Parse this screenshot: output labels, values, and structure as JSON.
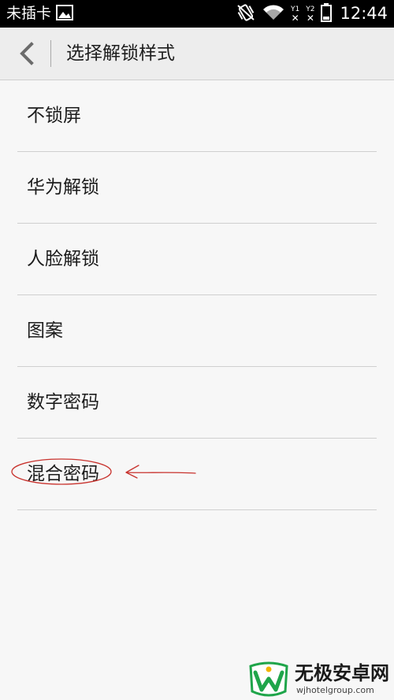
{
  "status_bar": {
    "carrier": "未插卡",
    "sim1": "1",
    "sim2": "2",
    "time": "12:44"
  },
  "header": {
    "title": "选择解锁样式"
  },
  "list": {
    "items": [
      {
        "label": "不锁屏"
      },
      {
        "label": "华为解锁"
      },
      {
        "label": "人脸解锁"
      },
      {
        "label": "图案"
      },
      {
        "label": "数字密码"
      },
      {
        "label": "混合密码"
      }
    ]
  },
  "annotation": {
    "color": "#c8322d"
  },
  "watermark": {
    "name": "无极安卓网",
    "url": "wjhotelgroup.com"
  },
  "colors": {
    "status_bar": "#000000",
    "header_bg": "#ededed",
    "page_bg": "#f7f7f7",
    "divider": "#cfcfcf",
    "logo_green": "#1fa54a"
  }
}
